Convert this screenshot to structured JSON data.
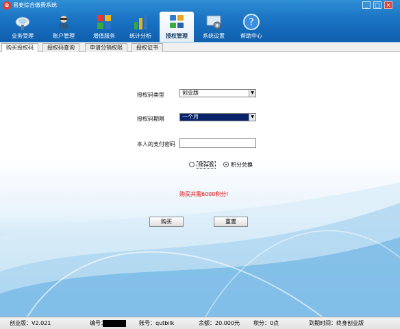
{
  "window": {
    "title": "易麦综合缴费系统",
    "logo_text": "e",
    "minimize": "_",
    "maximize": "□",
    "close": "×"
  },
  "nav": [
    {
      "label": "业务受理",
      "icon": "satellite-dish-icon"
    },
    {
      "label": "账户管理",
      "icon": "user-account-icon"
    },
    {
      "label": "增值服务",
      "icon": "puzzle-icon"
    },
    {
      "label": "统计分析",
      "icon": "bar-chart-icon"
    },
    {
      "label": "授权管理",
      "icon": "authorization-icon",
      "active": true
    },
    {
      "label": "系统设置",
      "icon": "gear-icon"
    },
    {
      "label": "帮助中心",
      "icon": "help-icon"
    }
  ],
  "subtabs": [
    {
      "label": "购买授权码",
      "active": true
    },
    {
      "label": "授权码查询"
    },
    {
      "label": "申请分销权限"
    },
    {
      "label": "授权证书"
    }
  ],
  "form": {
    "type_label": "授权码类型",
    "type_value": "创业版",
    "term_label": "授权码期限",
    "term_value": "一个月",
    "password_label": "本人的支付密码",
    "password_value": "",
    "radio_prestore": "预存款",
    "radio_points": "积分兑换",
    "selected_payment": "积分兑换",
    "notice": "购买共需6000积分!",
    "buy_button": "购买",
    "reset_button": "重置"
  },
  "status": {
    "version": "创业版：V2.021",
    "id_label": "编号：",
    "account": "账号：qutbilk",
    "balance": "余额：20.000元",
    "points": "积分：0点",
    "expiry": "到期时间：终身创业版"
  },
  "colors": {
    "header": "#1a73c3",
    "selected_term": "#0a246a",
    "notice": "#e00000"
  }
}
